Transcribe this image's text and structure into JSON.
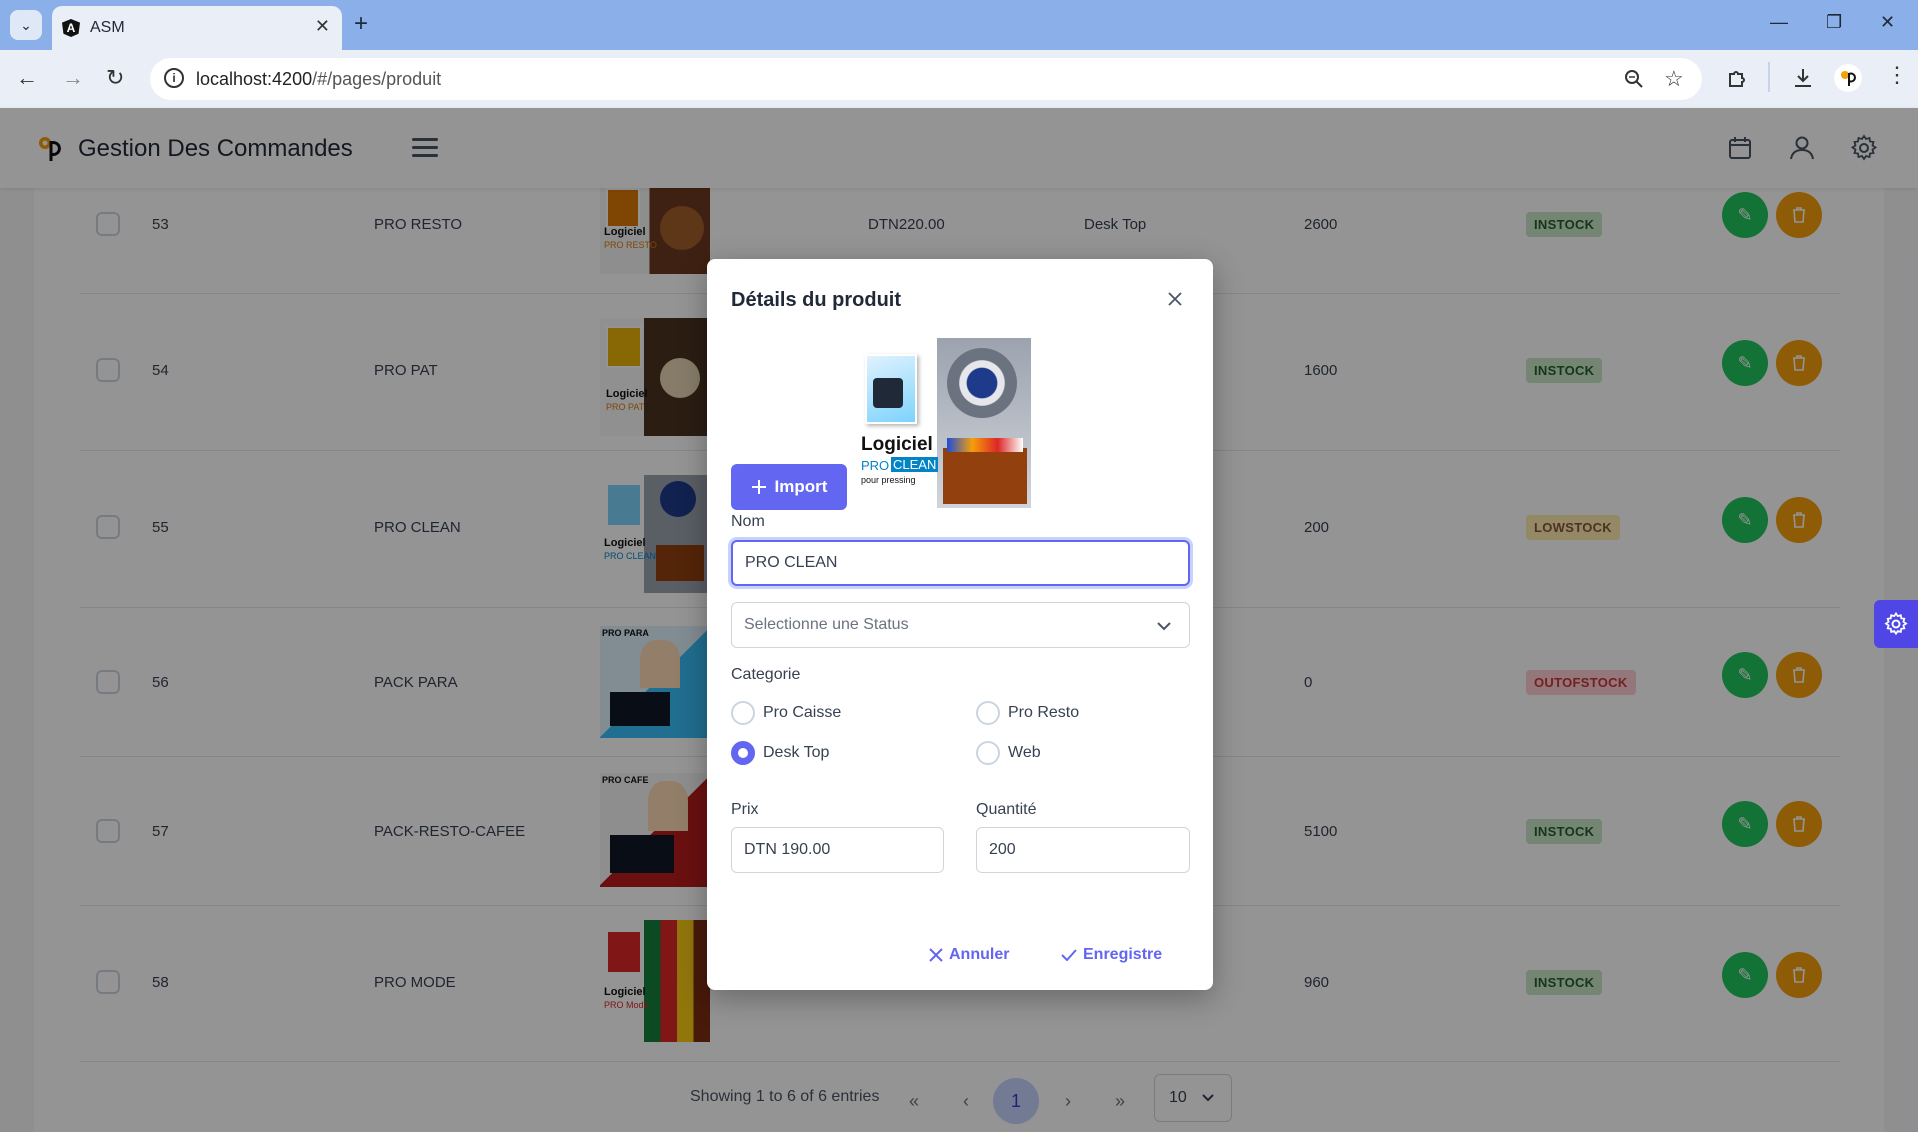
{
  "browser": {
    "tab_title": "ASM",
    "url_host": "localhost:4200",
    "url_path": "/#/pages/produit"
  },
  "app": {
    "title": "Gestion Des Commandes"
  },
  "products": [
    {
      "id": "53",
      "name": "PRO RESTO",
      "price": "DTN220.00",
      "category": "Desk Top",
      "quantity": "2600",
      "status": "INSTOCK"
    },
    {
      "id": "54",
      "name": "PRO PAT",
      "price": "",
      "category": "",
      "quantity": "1600",
      "status": "INSTOCK"
    },
    {
      "id": "55",
      "name": "PRO CLEAN",
      "price": "",
      "category": "",
      "quantity": "200",
      "status": "LOWSTOCK"
    },
    {
      "id": "56",
      "name": "PACK PARA",
      "price": "",
      "category": "",
      "quantity": "0",
      "status": "OUTOFSTOCK"
    },
    {
      "id": "57",
      "name": "PACK-RESTO-CAFEE",
      "price": "",
      "category": "",
      "quantity": "5100",
      "status": "INSTOCK"
    },
    {
      "id": "58",
      "name": "PRO MODE",
      "price": "",
      "category": "",
      "quantity": "960",
      "status": "INSTOCK"
    }
  ],
  "thumb_texts": {
    "logiciel": "Logiciel",
    "pro": "PRO",
    "resto": "RESTO",
    "pat": "PAT",
    "clean": "CLEAN",
    "mode": "Mode",
    "para": "PRO PARA",
    "cafe": "PRO CAFE"
  },
  "pagination": {
    "summary": "Showing 1 to 6 of 6 entries",
    "first": "«",
    "prev": "‹",
    "current": "1",
    "next": "›",
    "last": "»",
    "page_size": "10"
  },
  "modal": {
    "title": "Détails du produit",
    "image_logiciel": "Logiciel",
    "image_pro": "PRO",
    "image_clean": "CLEAN",
    "image_sub": "pour pressing",
    "import_label": "Import",
    "name_label": "Nom",
    "name_value": "PRO  CLEAN",
    "status_placeholder": "Selectionne une Status",
    "category_label": "Categorie",
    "categories": [
      {
        "label": "Pro Caisse",
        "checked": false
      },
      {
        "label": "Pro Resto",
        "checked": false
      },
      {
        "label": "Desk Top",
        "checked": true
      },
      {
        "label": "Web",
        "checked": false
      }
    ],
    "price_label": "Prix",
    "price_value": "DTN 190.00",
    "quantity_label": "Quantité",
    "quantity_value": "200",
    "cancel_label": "Annuler",
    "save_label": "Enregistre"
  },
  "colors": {
    "primary": "#6366f1",
    "edit": "#22c55e",
    "delete": "#f59e0b",
    "browser_tabbar": "#8aafe9"
  }
}
